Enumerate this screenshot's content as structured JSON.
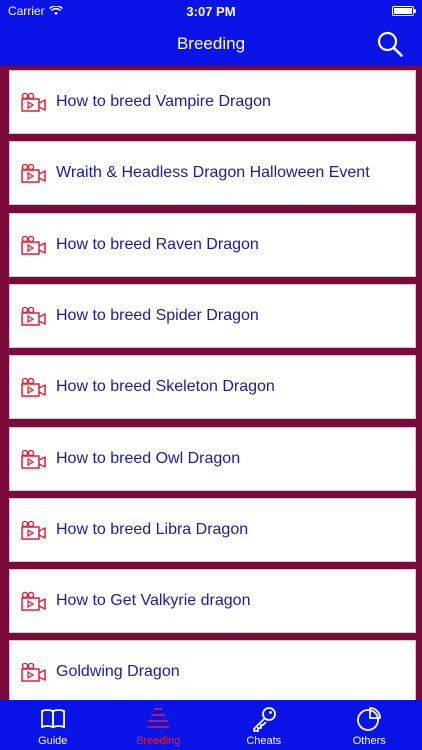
{
  "status": {
    "carrier": "Carrier",
    "time": "3:07 PM"
  },
  "nav": {
    "title": "Breeding"
  },
  "items": [
    "How to breed Vampire Dragon",
    "Wraith & Headless Dragon Halloween Event",
    "How to breed Raven Dragon",
    "How to breed Spider Dragon",
    "How to breed Skeleton Dragon",
    "How to breed Owl Dragon",
    "How to breed Libra Dragon",
    "How to Get Valkyrie dragon",
    "Goldwing Dragon"
  ],
  "tabs": [
    {
      "label": "Guide",
      "icon": "book-icon"
    },
    {
      "label": "Breeding",
      "icon": "layers-icon",
      "active": true
    },
    {
      "label": "Cheats",
      "icon": "key-icon"
    },
    {
      "label": "Others",
      "icon": "pie-chart-icon"
    }
  ],
  "colors": {
    "primary": "#0a14e6",
    "background": "#7a0a3a",
    "text": "#1c1ba0",
    "accent": "#e0203a"
  }
}
